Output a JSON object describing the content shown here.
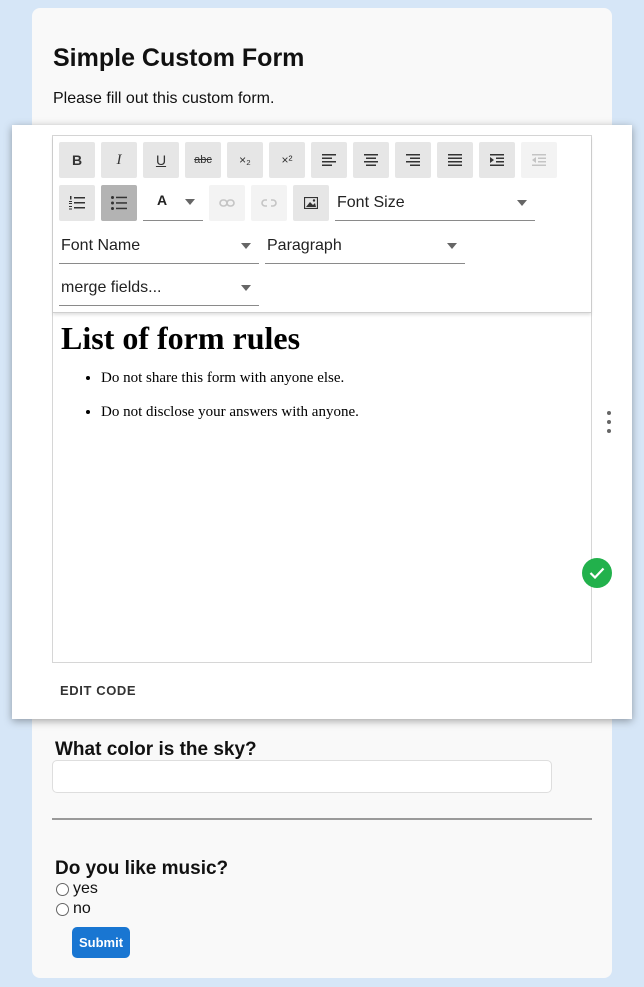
{
  "form": {
    "title": "Simple Custom Form",
    "description": "Please fill out this custom form.",
    "submit_label": "Submit"
  },
  "toolbar": {
    "bold_label": "B",
    "italic_label": "I",
    "underline_label": "U",
    "strikethrough_label": "abc",
    "subscript_label": "×₂",
    "superscript_label": "×²",
    "font_color_label": "A",
    "font_size_placeholder": "Font Size",
    "font_name_placeholder": "Font Name",
    "format_value": "Paragraph",
    "merge_fields_placeholder": "merge fields..."
  },
  "editor": {
    "heading": "List of form rules",
    "rules": [
      "Do not share this form with anyone else.",
      "Do not disclose your answers with anyone."
    ],
    "edit_code_label": "EDIT CODE"
  },
  "questions": {
    "q1": {
      "label": "What color is the sky?",
      "value": ""
    },
    "q2": {
      "label": "Do you like music?",
      "options": [
        "yes",
        "no"
      ]
    }
  },
  "colors": {
    "page_bg": "#d6e6f7",
    "submit_bg": "#1976d2",
    "done_bg": "#22b14c"
  }
}
